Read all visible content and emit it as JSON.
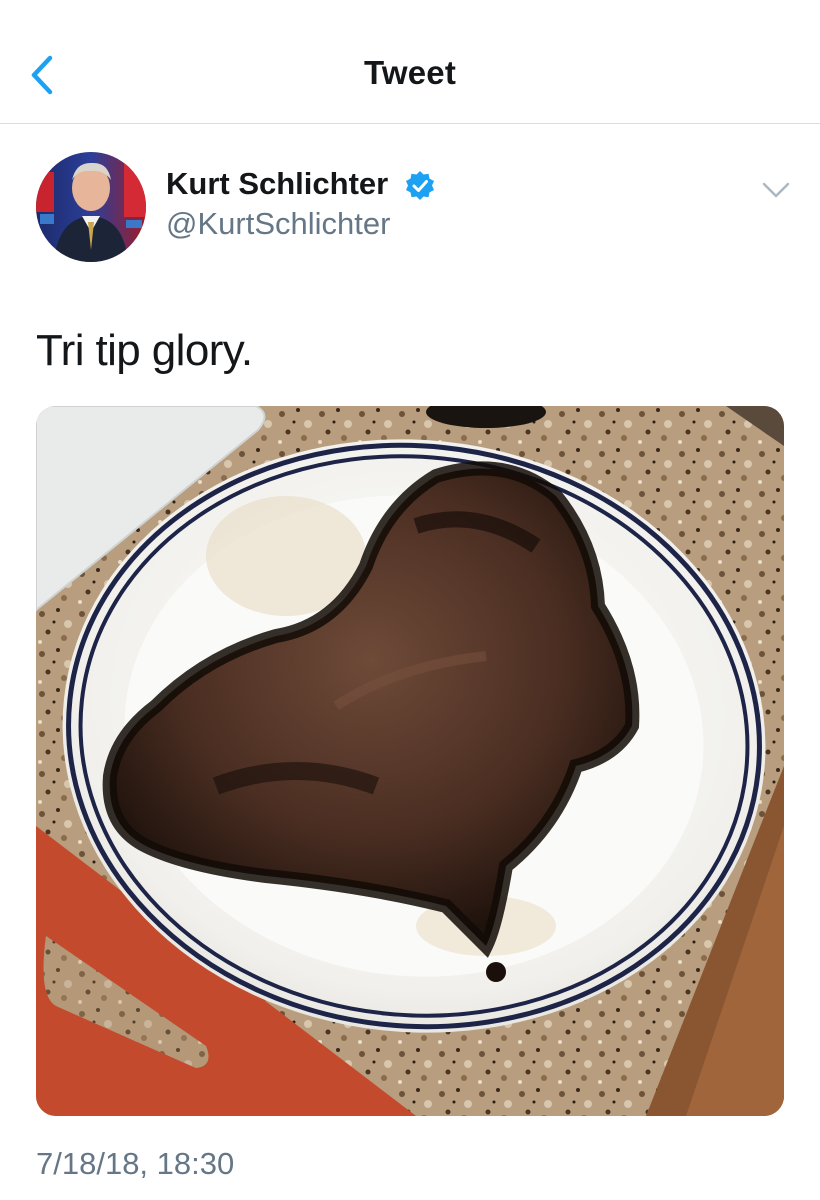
{
  "nav": {
    "back_icon": "chevron-left-icon",
    "title": "Tweet"
  },
  "tweet": {
    "author_name": "Kurt Schlichter",
    "verified_icon": "verified-badge-icon",
    "handle": "@KurtSchlichter",
    "menu_icon": "chevron-down-icon",
    "text": "Tri tip glory.",
    "timestamp": "7/18/18, 18:30"
  },
  "colors": {
    "accent": "#1da1f2",
    "text": "#14171a",
    "secondary_text": "#657786",
    "divider": "#dcdcdc"
  }
}
